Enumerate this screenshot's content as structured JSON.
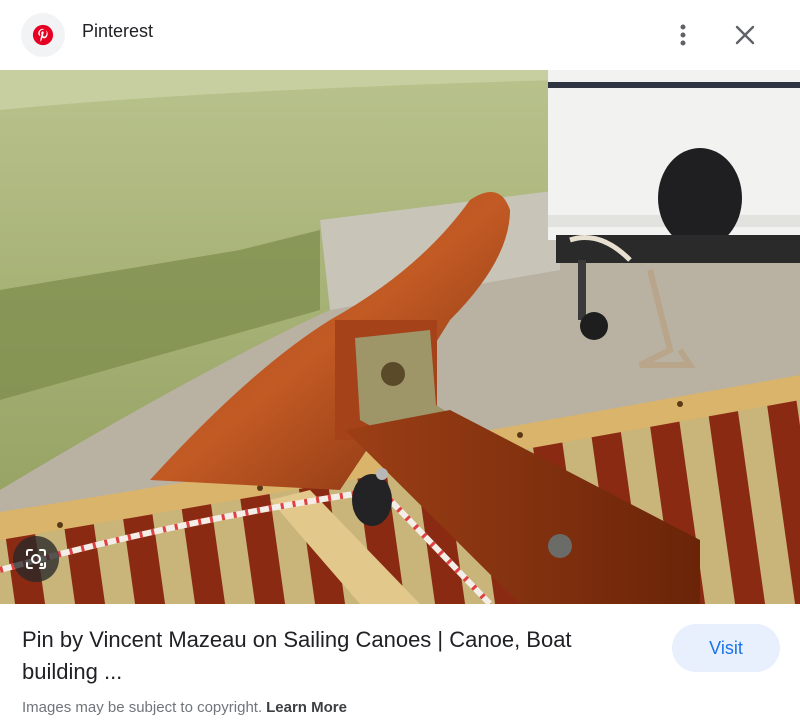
{
  "header": {
    "site_name": "Pinterest",
    "logo_icon": "pinterest-logo-icon",
    "more_icon": "more-vert-icon",
    "close_icon": "close-icon"
  },
  "image": {
    "lens_icon": "lens-icon"
  },
  "result": {
    "title": "Pin by Vincent Mazeau on Sailing Canoes | Canoe, Boat building ...",
    "visit_label": "Visit"
  },
  "footer": {
    "notice": "Images may be subject to copyright.",
    "learn_more": "Learn More"
  },
  "colors": {
    "brand_red": "#e60023",
    "visit_bg": "#e8f0fe",
    "visit_text": "#1a73e8"
  }
}
